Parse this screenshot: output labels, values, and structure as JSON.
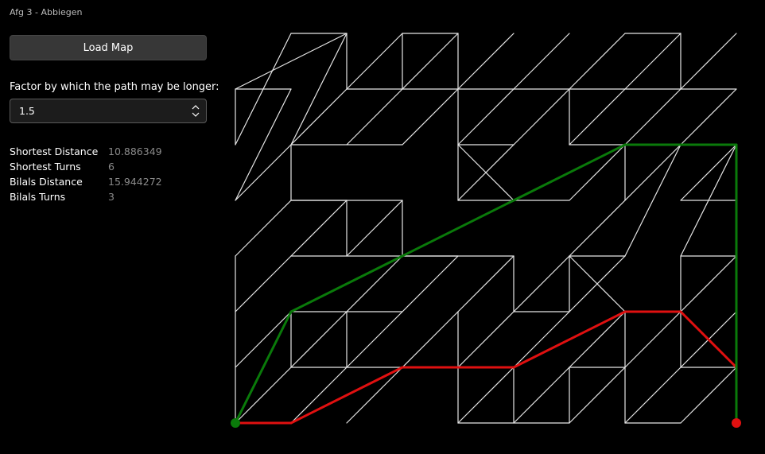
{
  "window": {
    "title": "Afg 3 - Abbiegen"
  },
  "toolbar": {
    "load_label": "Load Map"
  },
  "factor": {
    "label": "Factor by which the path may be longer:",
    "value": "1.5"
  },
  "stats": [
    {
      "label": "Shortest Distance",
      "value": "10.886349"
    },
    {
      "label": "Shortest Turns",
      "value": "6"
    },
    {
      "label": "Bilals Distance",
      "value": "15.944272"
    },
    {
      "label": "Bilals Turns",
      "value": "3"
    }
  ],
  "map": {
    "colors": {
      "edge": "#e6e6e6",
      "shortest": "#e01010",
      "bilal": "#0a7a0a",
      "start": "#0a7a0a",
      "end": "#e01010",
      "background": "#000000"
    },
    "grid": {
      "cols": 9,
      "rows": 7
    },
    "edges": [
      [
        [
          1,
          0
        ],
        [
          2,
          0
        ]
      ],
      [
        [
          2,
          0
        ],
        [
          2,
          1
        ]
      ],
      [
        [
          2,
          0
        ],
        [
          0,
          1
        ]
      ],
      [
        [
          1,
          0
        ],
        [
          0,
          2
        ]
      ],
      [
        [
          2,
          0
        ],
        [
          1,
          2
        ]
      ],
      [
        [
          2,
          1
        ],
        [
          3,
          0
        ]
      ],
      [
        [
          3,
          0
        ],
        [
          4,
          0
        ]
      ],
      [
        [
          3,
          0
        ],
        [
          3,
          1
        ]
      ],
      [
        [
          4,
          0
        ],
        [
          3,
          1
        ]
      ],
      [
        [
          4,
          0
        ],
        [
          4,
          1
        ]
      ],
      [
        [
          5,
          0
        ],
        [
          4,
          1
        ]
      ],
      [
        [
          6,
          0
        ],
        [
          5,
          1
        ]
      ],
      [
        [
          7,
          0
        ],
        [
          6,
          1
        ]
      ],
      [
        [
          7,
          0
        ],
        [
          8,
          0
        ]
      ],
      [
        [
          8,
          0
        ],
        [
          7,
          1
        ]
      ],
      [
        [
          8,
          0
        ],
        [
          8,
          1
        ]
      ],
      [
        [
          9,
          0
        ],
        [
          8,
          1
        ]
      ],
      [
        [
          2,
          1
        ],
        [
          9,
          1
        ]
      ],
      [
        [
          2,
          1
        ],
        [
          1,
          2
        ]
      ],
      [
        [
          3,
          1
        ],
        [
          2,
          2
        ]
      ],
      [
        [
          4,
          1
        ],
        [
          3,
          2
        ]
      ],
      [
        [
          5,
          1
        ],
        [
          4,
          2
        ]
      ],
      [
        [
          6,
          1
        ],
        [
          5,
          2
        ]
      ],
      [
        [
          7,
          1
        ],
        [
          6,
          2
        ]
      ],
      [
        [
          8,
          1
        ],
        [
          7,
          2
        ]
      ],
      [
        [
          9,
          1
        ],
        [
          8,
          2
        ]
      ],
      [
        [
          4,
          1
        ],
        [
          4,
          2
        ]
      ],
      [
        [
          6,
          1
        ],
        [
          6,
          2
        ]
      ],
      [
        [
          1,
          2
        ],
        [
          1,
          3
        ]
      ],
      [
        [
          0,
          2
        ],
        [
          0,
          1
        ]
      ],
      [
        [
          0,
          1
        ],
        [
          1,
          1
        ]
      ],
      [
        [
          1,
          1
        ],
        [
          0,
          3
        ]
      ],
      [
        [
          0,
          3
        ],
        [
          1,
          2
        ]
      ],
      [
        [
          1,
          2
        ],
        [
          3,
          2
        ]
      ],
      [
        [
          4,
          2
        ],
        [
          5,
          2
        ]
      ],
      [
        [
          4,
          2
        ],
        [
          5,
          3
        ]
      ],
      [
        [
          5,
          2
        ],
        [
          4,
          3
        ]
      ],
      [
        [
          4,
          3
        ],
        [
          5,
          3
        ]
      ],
      [
        [
          4,
          2
        ],
        [
          4,
          3
        ]
      ],
      [
        [
          6,
          2
        ],
        [
          7,
          2
        ]
      ],
      [
        [
          7,
          2
        ],
        [
          7,
          3
        ]
      ],
      [
        [
          7,
          2
        ],
        [
          6,
          3
        ]
      ],
      [
        [
          8,
          2
        ],
        [
          6,
          4
        ]
      ],
      [
        [
          8,
          2
        ],
        [
          7,
          4
        ]
      ],
      [
        [
          9,
          2
        ],
        [
          8,
          3
        ]
      ],
      [
        [
          9,
          2
        ],
        [
          8,
          4
        ]
      ],
      [
        [
          8,
          3
        ],
        [
          9,
          3
        ]
      ],
      [
        [
          1,
          3
        ],
        [
          3,
          3
        ]
      ],
      [
        [
          3,
          3
        ],
        [
          3,
          4
        ]
      ],
      [
        [
          1,
          3
        ],
        [
          2,
          3
        ]
      ],
      [
        [
          2,
          3
        ],
        [
          1,
          4
        ]
      ],
      [
        [
          3,
          3
        ],
        [
          2,
          4
        ]
      ],
      [
        [
          2,
          3
        ],
        [
          2,
          4
        ]
      ],
      [
        [
          0,
          4
        ],
        [
          0,
          7
        ]
      ],
      [
        [
          0,
          4
        ],
        [
          1,
          3
        ]
      ],
      [
        [
          0,
          5
        ],
        [
          1,
          4
        ]
      ],
      [
        [
          0,
          6
        ],
        [
          1,
          5
        ]
      ],
      [
        [
          0,
          7
        ],
        [
          1,
          6
        ]
      ],
      [
        [
          1,
          4
        ],
        [
          5,
          4
        ]
      ],
      [
        [
          5,
          4
        ],
        [
          5,
          5
        ]
      ],
      [
        [
          6,
          4
        ],
        [
          7,
          4
        ]
      ],
      [
        [
          6,
          4
        ],
        [
          6,
          5
        ]
      ],
      [
        [
          6,
          4
        ],
        [
          7,
          5
        ]
      ],
      [
        [
          7,
          4
        ],
        [
          6,
          5
        ]
      ],
      [
        [
          8,
          4
        ],
        [
          9,
          4
        ]
      ],
      [
        [
          8,
          4
        ],
        [
          8,
          5
        ]
      ],
      [
        [
          3,
          4
        ],
        [
          2,
          5
        ]
      ],
      [
        [
          4,
          4
        ],
        [
          3,
          5
        ]
      ],
      [
        [
          5,
          4
        ],
        [
          4,
          5
        ]
      ],
      [
        [
          6,
          4
        ],
        [
          5,
          5
        ]
      ],
      [
        [
          1,
          5
        ],
        [
          3,
          5
        ]
      ],
      [
        [
          2,
          5
        ],
        [
          1,
          6
        ]
      ],
      [
        [
          3,
          5
        ],
        [
          2,
          6
        ]
      ],
      [
        [
          4,
          5
        ],
        [
          3,
          6
        ]
      ],
      [
        [
          5,
          5
        ],
        [
          4,
          6
        ]
      ],
      [
        [
          6,
          5
        ],
        [
          5,
          6
        ]
      ],
      [
        [
          7,
          5
        ],
        [
          6,
          6
        ]
      ],
      [
        [
          8,
          5
        ],
        [
          7,
          6
        ]
      ],
      [
        [
          9,
          5
        ],
        [
          8,
          6
        ]
      ],
      [
        [
          9,
          4
        ],
        [
          8,
          5
        ]
      ],
      [
        [
          1,
          5
        ],
        [
          1,
          6
        ]
      ],
      [
        [
          2,
          5
        ],
        [
          2,
          6
        ]
      ],
      [
        [
          7,
          5
        ],
        [
          8,
          5
        ]
      ],
      [
        [
          7,
          5
        ],
        [
          7,
          7
        ]
      ],
      [
        [
          8,
          5
        ],
        [
          8,
          6
        ]
      ],
      [
        [
          9,
          5
        ],
        [
          9,
          6
        ]
      ],
      [
        [
          1,
          6
        ],
        [
          3,
          6
        ]
      ],
      [
        [
          3,
          6
        ],
        [
          2,
          7
        ]
      ],
      [
        [
          4,
          6
        ],
        [
          5,
          6
        ]
      ],
      [
        [
          4,
          6
        ],
        [
          4,
          7
        ]
      ],
      [
        [
          5,
          6
        ],
        [
          4,
          7
        ]
      ],
      [
        [
          6,
          6
        ],
        [
          7,
          6
        ]
      ],
      [
        [
          6,
          6
        ],
        [
          5,
          7
        ]
      ],
      [
        [
          7,
          6
        ],
        [
          6,
          7
        ]
      ],
      [
        [
          8,
          6
        ],
        [
          9,
          6
        ]
      ],
      [
        [
          8,
          6
        ],
        [
          7,
          7
        ]
      ],
      [
        [
          9,
          6
        ],
        [
          8,
          7
        ]
      ],
      [
        [
          2,
          6
        ],
        [
          1,
          7
        ]
      ],
      [
        [
          0,
          7
        ],
        [
          1,
          7
        ]
      ],
      [
        [
          4,
          7
        ],
        [
          6,
          7
        ]
      ],
      [
        [
          7,
          7
        ],
        [
          8,
          7
        ]
      ],
      [
        [
          5,
          6
        ],
        [
          5,
          7
        ]
      ],
      [
        [
          6,
          6
        ],
        [
          6,
          7
        ]
      ],
      [
        [
          4,
          5
        ],
        [
          4,
          6
        ]
      ],
      [
        [
          5,
          5
        ],
        [
          6,
          5
        ]
      ],
      [
        [
          5,
          3
        ],
        [
          6,
          3
        ]
      ],
      [
        [
          3,
          4
        ],
        [
          4,
          4
        ]
      ]
    ],
    "shortest_path": [
      [
        0,
        7
      ],
      [
        1,
        7
      ],
      [
        3,
        6
      ],
      [
        5,
        6
      ],
      [
        7,
        5
      ],
      [
        8,
        5
      ],
      [
        9,
        6
      ],
      [
        9,
        7
      ]
    ],
    "bilal_path": [
      [
        0,
        7
      ],
      [
        1,
        5
      ],
      [
        3,
        4
      ],
      [
        5,
        3
      ],
      [
        7,
        2
      ],
      [
        9,
        2
      ],
      [
        9,
        7
      ]
    ],
    "start": [
      0,
      7
    ],
    "end": [
      9,
      7
    ]
  }
}
